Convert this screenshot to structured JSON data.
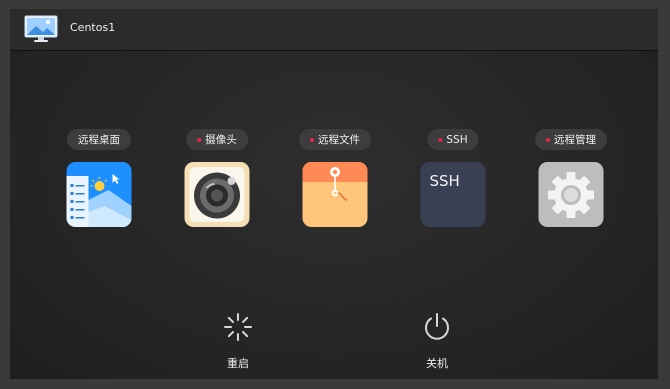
{
  "window": {
    "title": "Centos1",
    "icon": "monitor-icon"
  },
  "apps": [
    {
      "label": "远程桌面",
      "icon": "remote-desktop-icon",
      "dot": false
    },
    {
      "label": "摄像头",
      "icon": "camera-icon",
      "dot": true
    },
    {
      "label": "远程文件",
      "icon": "remote-files-icon",
      "dot": true
    },
    {
      "label": "SSH",
      "icon": "ssh-icon",
      "dot": true,
      "icon_text": "SSH"
    },
    {
      "label": "远程管理",
      "icon": "gear-icon",
      "dot": true
    }
  ],
  "actions": [
    {
      "label": "重启",
      "icon": "restart-icon"
    },
    {
      "label": "关机",
      "icon": "power-icon"
    }
  ],
  "colors": {
    "dot": "#e5284a",
    "remote_desktop": "#1e8fff",
    "camera": "#f6dfb4",
    "files": "#ffa24a",
    "ssh": "#3a4054",
    "manage": "#bdbdbd"
  }
}
